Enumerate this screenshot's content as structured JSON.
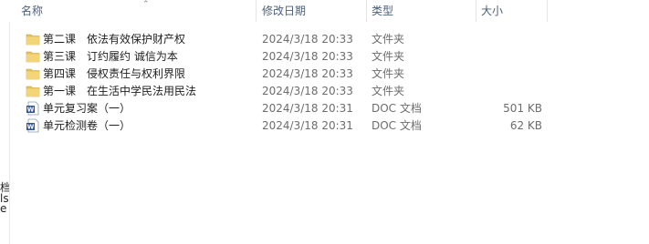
{
  "left_pane_fragments": [
    "档",
    "ls",
    "e"
  ],
  "columns": {
    "name": "名称",
    "date": "修改日期",
    "type": "类型",
    "size": "大小"
  },
  "files": [
    {
      "name": "第二课　依法有效保护财产权",
      "date": "2024/3/18 20:33",
      "type": "文件夹",
      "size": "",
      "icon": "folder-icon"
    },
    {
      "name": "第三课　订约履约 诚信为本",
      "date": "2024/3/18 20:33",
      "type": "文件夹",
      "size": "",
      "icon": "folder-icon"
    },
    {
      "name": "第四课　侵权责任与权利界限",
      "date": "2024/3/18 20:33",
      "type": "文件夹",
      "size": "",
      "icon": "folder-icon"
    },
    {
      "name": "第一课　在生活中学民法用民法",
      "date": "2024/3/18 20:33",
      "type": "文件夹",
      "size": "",
      "icon": "folder-icon"
    },
    {
      "name": "单元复习案（一）",
      "date": "2024/3/18 20:31",
      "type": "DOC 文档",
      "size": "501 KB",
      "icon": "word-doc-icon"
    },
    {
      "name": "单元检测卷（一）",
      "date": "2024/3/18 20:31",
      "type": "DOC 文档",
      "size": "62 KB",
      "icon": "word-doc-icon"
    }
  ],
  "colors": {
    "header_text": "#4c607a",
    "folder": "#e8c15a",
    "word_blue": "#2b5797"
  }
}
